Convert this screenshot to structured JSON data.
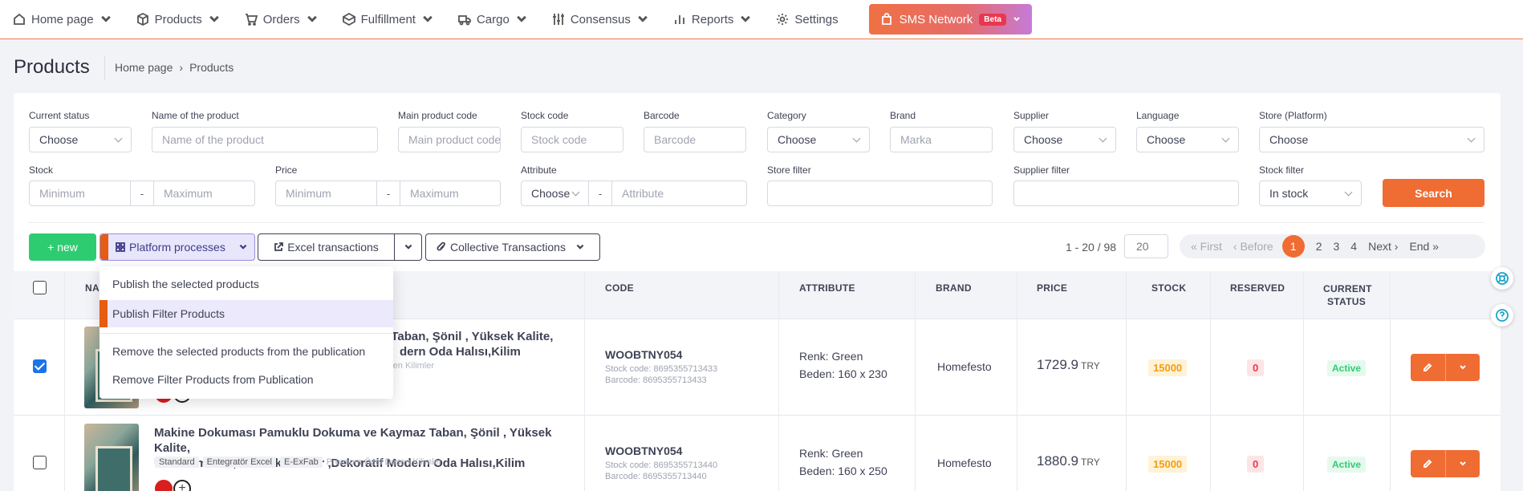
{
  "nav": {
    "items": [
      {
        "label": "Home page",
        "icon": "home-icon"
      },
      {
        "label": "Products",
        "icon": "box-icon"
      },
      {
        "label": "Orders",
        "icon": "cart-icon"
      },
      {
        "label": "Fulfillment",
        "icon": "package-icon"
      },
      {
        "label": "Cargo",
        "icon": "truck-icon"
      },
      {
        "label": "Consensus",
        "icon": "sliders-icon"
      },
      {
        "label": "Reports",
        "icon": "bar-chart-icon"
      },
      {
        "label": "Settings",
        "icon": "gear-icon"
      }
    ],
    "sms": {
      "label": "SMS Network",
      "badge": "Beta"
    }
  },
  "header": {
    "title": "Products",
    "breadcrumb": [
      "Home page",
      "Products"
    ]
  },
  "filters": {
    "current_status": {
      "label": "Current status",
      "value": "Choose"
    },
    "product_name": {
      "label": "Name of the product",
      "placeholder": "Name of the product"
    },
    "main_code": {
      "label": "Main product code",
      "placeholder": "Main product code"
    },
    "stock_code": {
      "label": "Stock code",
      "placeholder": "Stock code"
    },
    "barcode": {
      "label": "Barcode",
      "placeholder": "Barcode"
    },
    "category": {
      "label": "Category",
      "value": "Choose"
    },
    "brand": {
      "label": "Brand",
      "placeholder": "Marka"
    },
    "supplier": {
      "label": "Supplier",
      "value": "Choose"
    },
    "language": {
      "label": "Language",
      "value": "Choose"
    },
    "store": {
      "label": "Store (Platform)",
      "value": "Choose"
    },
    "stock": {
      "label": "Stock",
      "min": "Minimum",
      "max": "Maximum"
    },
    "price": {
      "label": "Price",
      "min": "Minimum",
      "max": "Maximum"
    },
    "attribute": {
      "label": "Attribute",
      "value": "Choose",
      "placeholder": "Attribute"
    },
    "store_filter": {
      "label": "Store filter"
    },
    "supplier_filter": {
      "label": "Supplier filter"
    },
    "stock_filter": {
      "label": "Stock filter",
      "value": "In stock"
    },
    "search_label": "Search",
    "dash": "-"
  },
  "toolbar": {
    "new_label": "+ new",
    "platform_label": "Platform processes",
    "excel_label": "Excel transactions",
    "collective_label": "Collective Transactions"
  },
  "pagination": {
    "range": "1 - 20 / 98",
    "per_page": "20",
    "first": "« First",
    "before": "‹ Before",
    "pages": [
      "1",
      "2",
      "3",
      "4"
    ],
    "current": "1",
    "next": "Next ›",
    "end": "End »"
  },
  "dropdown": {
    "items": [
      "Publish the selected products",
      "Publish Filter Products",
      "Remove the selected products from the publication",
      "Remove Filter Products from Publication"
    ]
  },
  "table": {
    "headers": {
      "name": "NA",
      "code": "CODE",
      "attribute": "ATTRIBUTE",
      "brand": "BRAND",
      "price": "PRICE",
      "stock": "STOCK",
      "reserved": "RESERVED",
      "status_1": "CURRENT",
      "status_2": "STATUS"
    },
    "rows": [
      {
        "checked": true,
        "name_line1": "maz Taban, Şönil , Yüksek Kalite,",
        "name_line2": "dern Oda Halısı,Kilim",
        "tag_muted": "zel Desen Kilimler",
        "code": "WOOBTNY054",
        "stock_code": "Stock code: 8695355713433",
        "barcode": "Barcode: 8695355713433",
        "attr1": "Renk: Green",
        "attr2": "Beden: 160 x 230",
        "brand": "Homefesto",
        "price": "1729.9",
        "currency": "TRY",
        "stock": "15000",
        "reserved": "0",
        "status": "Active"
      },
      {
        "checked": false,
        "name_line1": "Makine Dokuması Pamuklu Dokuma ve Kaymaz Taban, Şönil , Yüksek Kalite,",
        "name_line2": "Uzun Ömürlü ,İnce Yıkanabilir ,Dekoratif Modern Oda Halısı,Kilim",
        "tags": [
          "Standard",
          "Entegratör Excel",
          "E-ExFab"
        ],
        "tag_muted": "Premium Özel Desen Kilimler",
        "code": "WOOBTNY054",
        "stock_code": "Stock code: 8695355713440",
        "barcode": "Barcode: 8695355713440",
        "attr1": "Renk: Green",
        "attr2": "Beden: 160 x 250",
        "brand": "Homefesto",
        "price": "1880.9",
        "currency": "TRY",
        "stock": "15000",
        "reserved": "0",
        "status": "Active"
      }
    ]
  },
  "colors": {
    "accent": "#ef6c33",
    "success": "#2ecc71",
    "danger": "#e8384f",
    "warning": "#f29d17",
    "platform": "#e8e6fb"
  }
}
